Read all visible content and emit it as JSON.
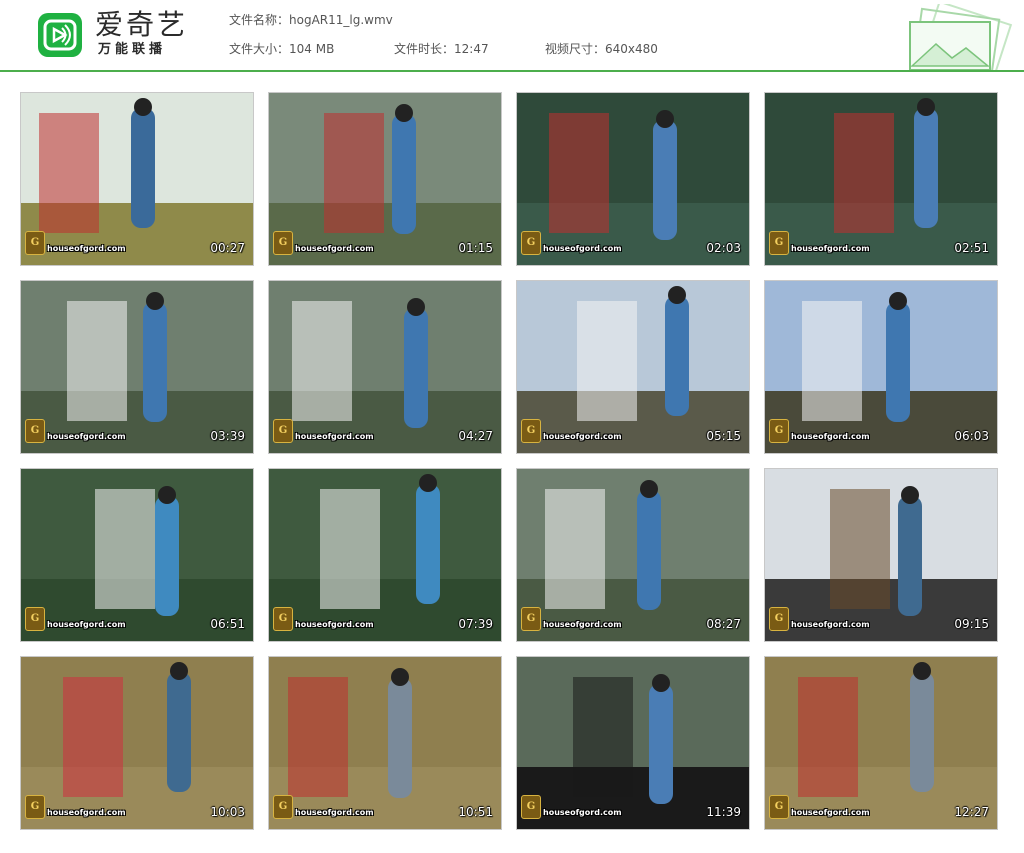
{
  "app": {
    "logo_text": "爱奇艺",
    "logo_subtitle": "万能联播",
    "brand_color": "#1fb141",
    "accent_line_color": "#4cae4c"
  },
  "file_info": {
    "name_label": "文件名称：",
    "name_value": "hogAR11_lg.wmv",
    "size_label": "文件大小：",
    "size_value": "104 MB",
    "duration_label": "文件时长：",
    "duration_value": "12:47",
    "dimensions_label": "视频尺寸：",
    "dimensions_value": "640x480"
  },
  "thumbnails": [
    {
      "timestamp": "00:27",
      "watermark": "houseofgord.com",
      "badge": "G",
      "scene": "closeup-frame"
    },
    {
      "timestamp": "01:15",
      "watermark": "houseofgord.com",
      "badge": "G",
      "scene": "porch-lift"
    },
    {
      "timestamp": "02:03",
      "watermark": "houseofgord.com",
      "badge": "G",
      "scene": "closeup-wrap"
    },
    {
      "timestamp": "02:51",
      "watermark": "houseofgord.com",
      "badge": "G",
      "scene": "closeup-wrap"
    },
    {
      "timestamp": "03:39",
      "watermark": "houseofgord.com",
      "badge": "G",
      "scene": "balcony"
    },
    {
      "timestamp": "04:27",
      "watermark": "houseofgord.com",
      "badge": "G",
      "scene": "balcony"
    },
    {
      "timestamp": "05:15",
      "watermark": "houseofgord.com",
      "badge": "G",
      "scene": "gazebo"
    },
    {
      "timestamp": "06:03",
      "watermark": "houseofgord.com",
      "badge": "G",
      "scene": "gazebo-sky"
    },
    {
      "timestamp": "06:51",
      "watermark": "houseofgord.com",
      "badge": "G",
      "scene": "porch-trees"
    },
    {
      "timestamp": "07:39",
      "watermark": "houseofgord.com",
      "badge": "G",
      "scene": "porch-trees"
    },
    {
      "timestamp": "08:27",
      "watermark": "houseofgord.com",
      "badge": "G",
      "scene": "balcony"
    },
    {
      "timestamp": "09:15",
      "watermark": "houseofgord.com",
      "badge": "G",
      "scene": "sky-up"
    },
    {
      "timestamp": "10:03",
      "watermark": "houseofgord.com",
      "badge": "G",
      "scene": "ground"
    },
    {
      "timestamp": "10:51",
      "watermark": "houseofgord.com",
      "badge": "G",
      "scene": "ground-frame"
    },
    {
      "timestamp": "11:39",
      "watermark": "houseofgord.com",
      "badge": "G",
      "scene": "closeup-people"
    },
    {
      "timestamp": "12:27",
      "watermark": "houseofgord.com",
      "badge": "G",
      "scene": "ground-frame"
    }
  ]
}
